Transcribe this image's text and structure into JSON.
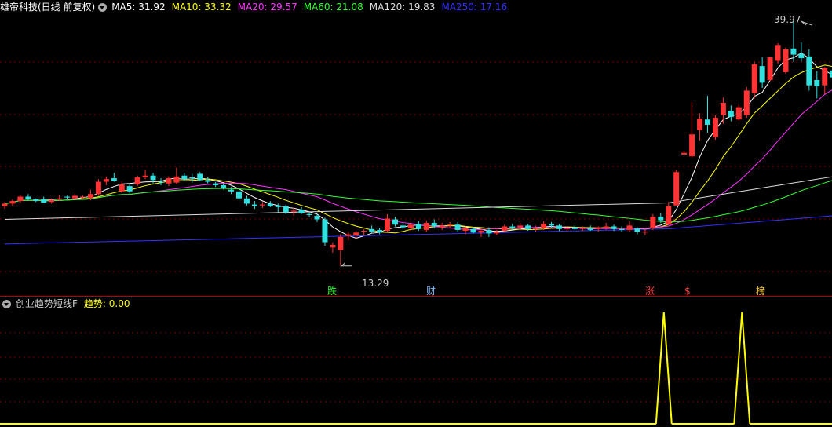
{
  "header": {
    "title": "雄帝科技(日线 前复权)",
    "ma": [
      {
        "text": "MA5: 31.92",
        "color": "#ffffff"
      },
      {
        "text": "MA10: 33.32",
        "color": "#ffff00"
      },
      {
        "text": "MA20: 29.57",
        "color": "#ff33ff"
      },
      {
        "text": "MA60: 21.08",
        "color": "#33ff33"
      },
      {
        "text": "MA120: 19.83",
        "color": "#dddddd"
      },
      {
        "text": "MA250: 17.16",
        "color": "#3333ff"
      }
    ]
  },
  "indicator": {
    "name": "创业趋势短线F",
    "value_label": "趋势: 0.00"
  },
  "annotations": {
    "high": "39.97",
    "low": "13.29",
    "markers": [
      {
        "text": "跌",
        "color": "#33ff33"
      },
      {
        "text": "财",
        "color": "#88bbff"
      },
      {
        "text": "涨",
        "color": "#ff4040"
      },
      {
        "text": "$",
        "color": "#ff4040"
      },
      {
        "text": "榜",
        "color": "#ffcc33"
      }
    ]
  },
  "colors": {
    "up": "#ff3333",
    "down": "#33e0e0",
    "grid": "#7a0000",
    "divider": "#aa0000",
    "signal": "#ffff00"
  },
  "chart_data": {
    "type": "candlestick",
    "price_ylim": [
      10.5,
      42.2
    ],
    "candles": [
      [
        20.1,
        20.6,
        19.8,
        20.4
      ],
      [
        20.4,
        20.9,
        20.1,
        20.7
      ],
      [
        20.7,
        21.4,
        20.5,
        21.2
      ],
      [
        21.2,
        21.5,
        20.8,
        20.9
      ],
      [
        20.9,
        21.0,
        20.6,
        20.7
      ],
      [
        20.9,
        21.2,
        20.6,
        20.5
      ],
      [
        20.6,
        21.0,
        20.4,
        20.8
      ],
      [
        21.0,
        21.4,
        20.7,
        21.0
      ],
      [
        21.2,
        21.3,
        20.9,
        21.1
      ],
      [
        21.0,
        21.5,
        20.8,
        21.3
      ],
      [
        21.1,
        21.3,
        20.9,
        21.2
      ],
      [
        21.0,
        22.0,
        20.8,
        21.5
      ],
      [
        21.5,
        23.2,
        21.3,
        22.9
      ],
      [
        22.9,
        23.5,
        22.5,
        23.2
      ],
      [
        23.3,
        23.9,
        22.9,
        23.0
      ],
      [
        21.8,
        22.9,
        21.6,
        22.6
      ],
      [
        22.4,
        22.6,
        21.5,
        21.8
      ],
      [
        22.6,
        23.6,
        22.4,
        23.4
      ],
      [
        23.4,
        24.3,
        23.2,
        23.6
      ],
      [
        23.6,
        23.9,
        22.7,
        23.1
      ],
      [
        22.9,
        23.3,
        22.5,
        22.8
      ],
      [
        22.7,
        23.5,
        22.4,
        23.3
      ],
      [
        22.8,
        24.5,
        22.6,
        23.5
      ],
      [
        23.6,
        23.9,
        23.0,
        23.2
      ],
      [
        23.4,
        23.8,
        22.8,
        23.3
      ],
      [
        23.8,
        24.0,
        23.0,
        23.1
      ],
      [
        23.1,
        23.4,
        22.7,
        22.9
      ],
      [
        22.7,
        22.9,
        22.3,
        22.5
      ],
      [
        22.5,
        22.7,
        22.0,
        22.2
      ],
      [
        22.0,
        22.3,
        21.5,
        21.8
      ],
      [
        21.8,
        22.0,
        20.8,
        21.0
      ],
      [
        21.0,
        21.3,
        20.2,
        20.4
      ],
      [
        20.3,
        20.7,
        19.8,
        20.1
      ],
      [
        20.2,
        20.6,
        19.9,
        20.3
      ],
      [
        20.4,
        20.7,
        20.0,
        20.1
      ],
      [
        20.2,
        20.4,
        19.4,
        20.0
      ],
      [
        20.1,
        20.3,
        19.2,
        19.4
      ],
      [
        19.5,
        19.9,
        19.0,
        19.6
      ],
      [
        19.7,
        20.0,
        19.2,
        19.3
      ],
      [
        19.2,
        19.4,
        18.9,
        19.1
      ],
      [
        19.0,
        19.2,
        18.3,
        18.6
      ],
      [
        18.6,
        18.8,
        15.6,
        16.0
      ],
      [
        15.4,
        16.0,
        14.8,
        15.7
      ],
      [
        15.1,
        16.9,
        13.3,
        16.6
      ],
      [
        16.7,
        17.2,
        16.2,
        16.9
      ],
      [
        16.8,
        17.3,
        16.4,
        17.1
      ],
      [
        17.2,
        17.5,
        16.8,
        17.3
      ],
      [
        17.5,
        17.9,
        17.0,
        17.2
      ],
      [
        17.4,
        17.6,
        16.9,
        17.1
      ],
      [
        17.3,
        19.2,
        17.1,
        18.7
      ],
      [
        18.6,
        18.9,
        17.8,
        18.0
      ],
      [
        17.9,
        18.2,
        17.4,
        17.7
      ],
      [
        17.6,
        18.3,
        17.3,
        18.0
      ],
      [
        18.1,
        18.4,
        17.3,
        17.5
      ],
      [
        17.4,
        18.5,
        17.2,
        18.2
      ],
      [
        18.2,
        18.6,
        17.6,
        17.8
      ],
      [
        17.7,
        18.2,
        17.4,
        17.9
      ],
      [
        17.9,
        18.3,
        17.6,
        18.0
      ],
      [
        18.0,
        18.3,
        17.2,
        17.4
      ],
      [
        17.3,
        17.8,
        16.9,
        17.6
      ],
      [
        17.5,
        17.7,
        17.0,
        17.1
      ],
      [
        17.1,
        17.6,
        16.6,
        17.3
      ],
      [
        17.4,
        17.7,
        16.6,
        17.0
      ],
      [
        17.0,
        17.4,
        16.8,
        17.2
      ],
      [
        17.3,
        18.0,
        17.1,
        17.8
      ],
      [
        17.8,
        18.1,
        17.4,
        17.6
      ],
      [
        17.7,
        18.2,
        17.4,
        17.9
      ],
      [
        17.9,
        18.1,
        17.3,
        17.5
      ],
      [
        17.5,
        17.9,
        17.2,
        17.6
      ],
      [
        17.6,
        18.4,
        17.4,
        18.1
      ],
      [
        18.1,
        18.3,
        17.6,
        17.9
      ],
      [
        17.9,
        18.1,
        17.3,
        17.5
      ],
      [
        17.5,
        17.8,
        17.3,
        17.6
      ],
      [
        17.7,
        17.9,
        17.4,
        17.5
      ],
      [
        17.5,
        17.8,
        17.3,
        17.6
      ],
      [
        17.6,
        17.9,
        17.3,
        17.4
      ],
      [
        17.5,
        17.8,
        17.2,
        17.7
      ],
      [
        17.6,
        18.2,
        17.4,
        17.8
      ],
      [
        17.8,
        18.0,
        17.3,
        17.5
      ],
      [
        17.5,
        17.8,
        17.2,
        17.4
      ],
      [
        17.4,
        18.4,
        17.2,
        17.9
      ],
      [
        17.6,
        17.7,
        16.9,
        17.2
      ],
      [
        17.1,
        17.5,
        16.8,
        17.2
      ],
      [
        17.6,
        19.2,
        17.4,
        18.9
      ],
      [
        18.9,
        19.3,
        18.2,
        18.5
      ],
      [
        18.0,
        20.6,
        18.0,
        20.1
      ],
      [
        20.2,
        24.3,
        20.2,
        24.0
      ],
      [
        26.0,
        26.4,
        26.0,
        26.2
      ],
      [
        25.8,
        32.0,
        25.7,
        28.3
      ],
      [
        28.8,
        30.7,
        27.6,
        30.1
      ],
      [
        30.0,
        32.7,
        28.5,
        29.4
      ],
      [
        28.0,
        30.5,
        27.7,
        30.2
      ],
      [
        30.5,
        32.5,
        29.5,
        31.9
      ],
      [
        31.0,
        31.6,
        29.8,
        30.3
      ],
      [
        30.0,
        31.7,
        29.9,
        31.4
      ],
      [
        30.5,
        33.7,
        30.2,
        33.3
      ],
      [
        33.0,
        36.6,
        32.4,
        36.3
      ],
      [
        36.1,
        37.1,
        33.6,
        34.2
      ],
      [
        34.5,
        37.2,
        34.4,
        37.1
      ],
      [
        36.7,
        38.7,
        36.4,
        38.5
      ],
      [
        35.4,
        38.2,
        35.2,
        38.0
      ],
      [
        38.1,
        41.2,
        36.6,
        37.4
      ],
      [
        37.5,
        38.8,
        36.6,
        37.0
      ],
      [
        37.2,
        38.0,
        33.3,
        33.9
      ],
      [
        34.5,
        35.5,
        32.4,
        33.8
      ],
      [
        33.9,
        36.0,
        32.9,
        35.9
      ],
      [
        35.6,
        35.9,
        33.3,
        34.8
      ],
      [
        34.5,
        34.7,
        33.9,
        34.3
      ]
    ],
    "indicator_spikes": [
      84,
      94
    ],
    "indicator_ylim": [
      0,
      1
    ]
  }
}
